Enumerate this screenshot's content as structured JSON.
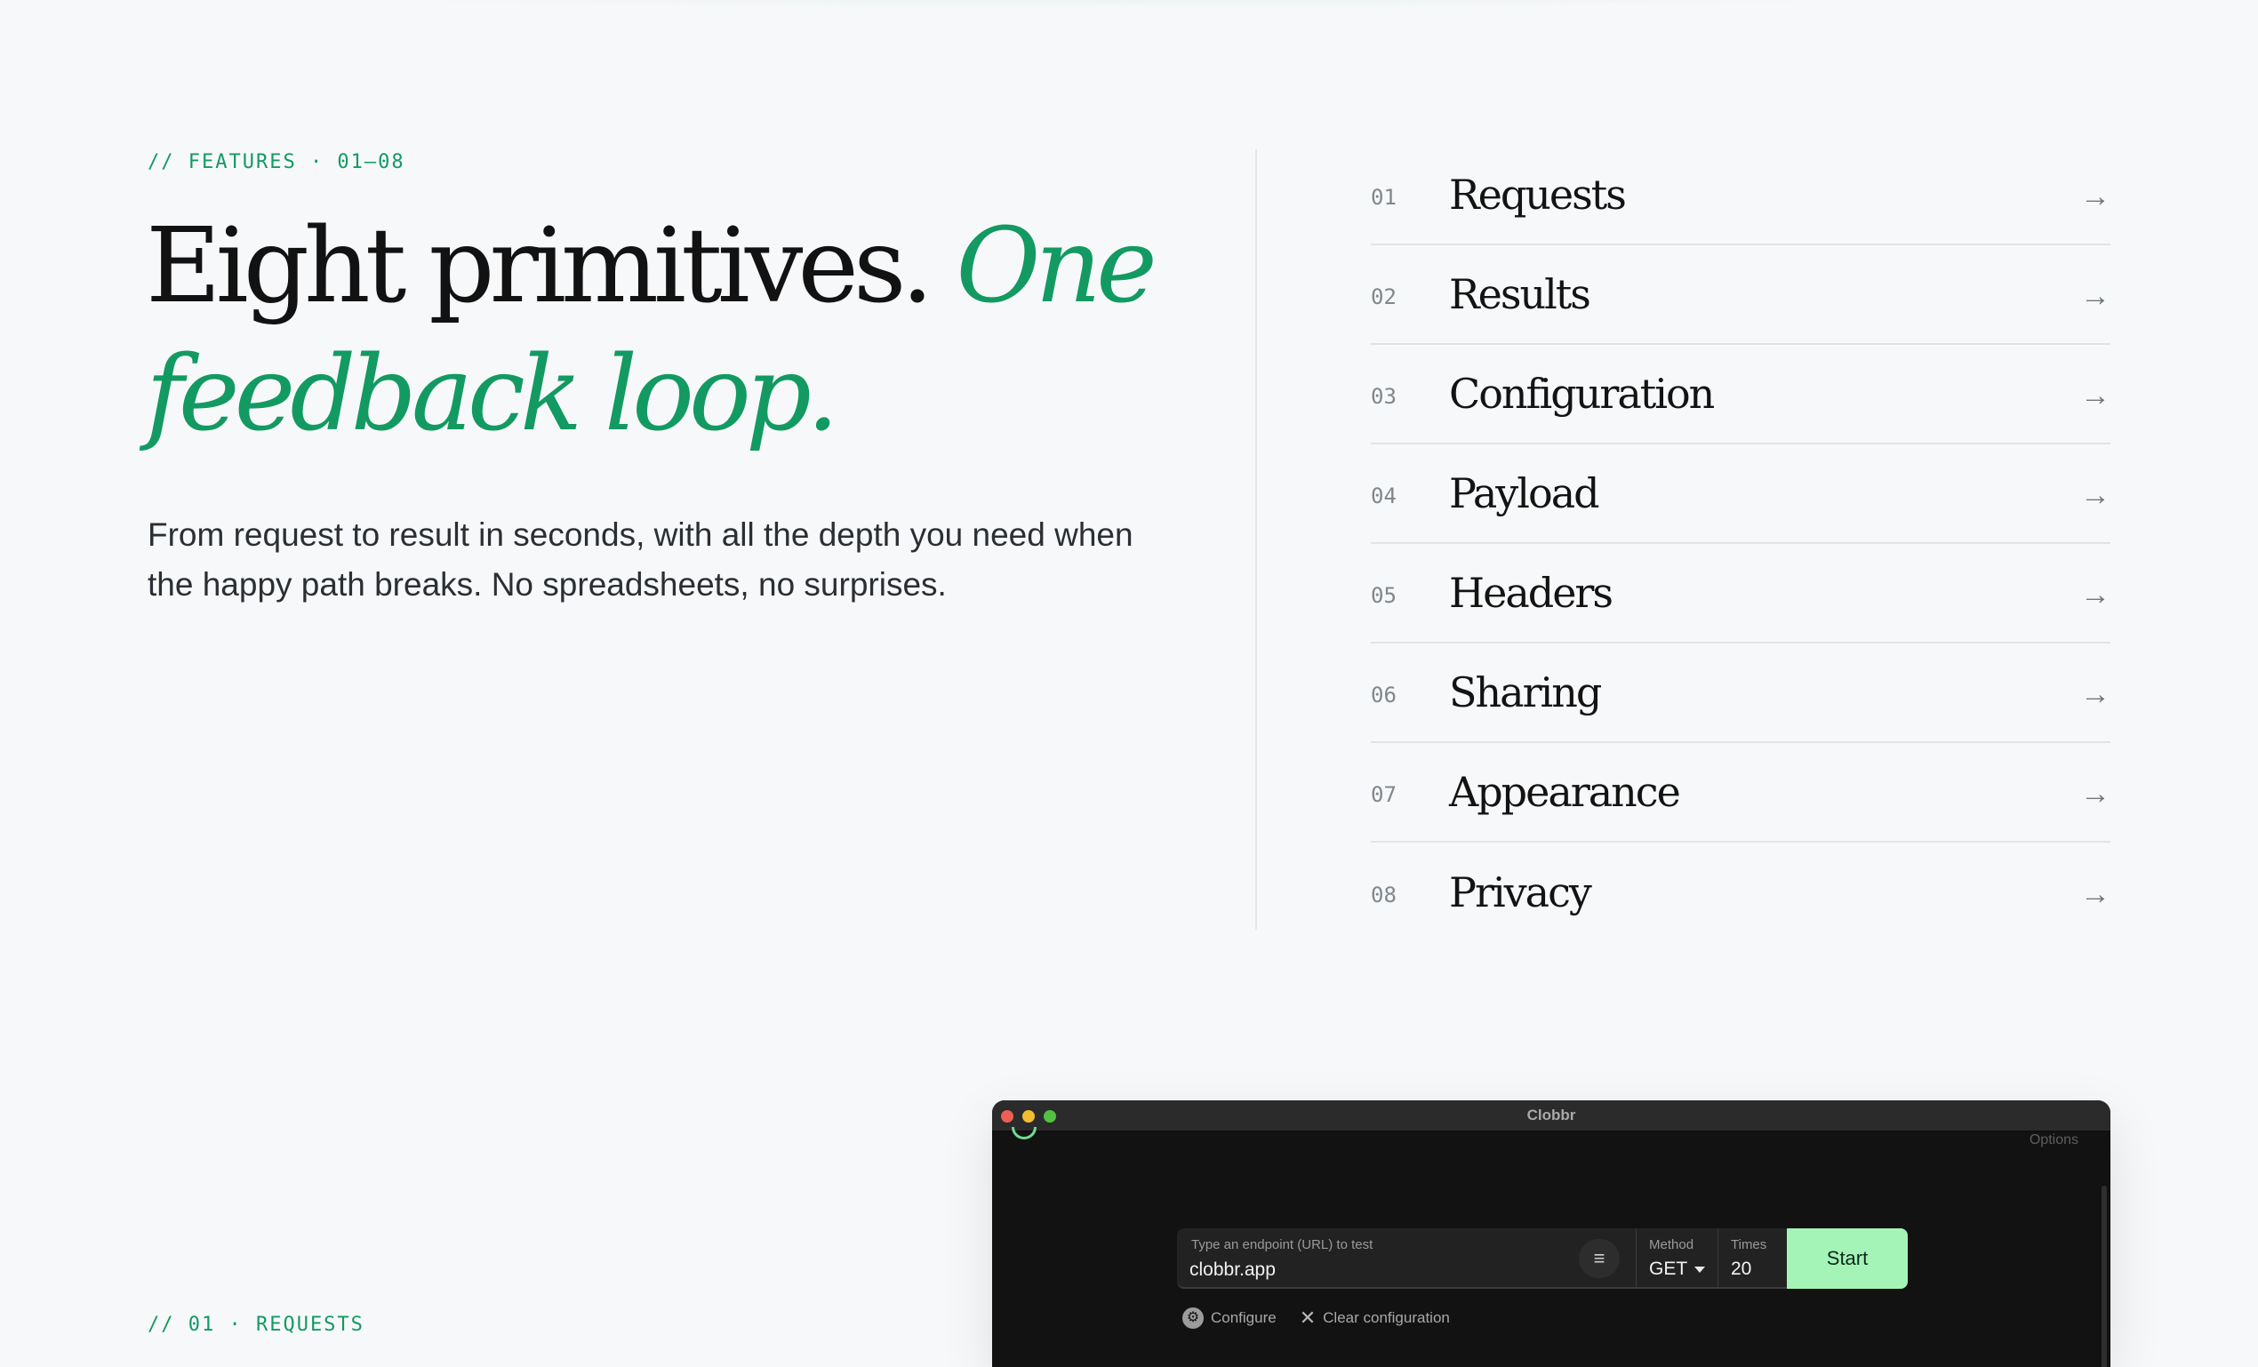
{
  "features_section": {
    "eyebrow": "// FEATURES · 01–08",
    "headline_plain": "Eight primitives.",
    "headline_accent": "One feedback loop.",
    "lede": "From request to result in seconds, with all the depth you need when the happy path breaks. No spreadsheets, no surprises.",
    "accent_color": "#129a62",
    "arrow_glyph": "→",
    "items": [
      {
        "num": "01",
        "label": "Requests"
      },
      {
        "num": "02",
        "label": "Results"
      },
      {
        "num": "03",
        "label": "Configuration"
      },
      {
        "num": "04",
        "label": "Payload"
      },
      {
        "num": "05",
        "label": "Headers"
      },
      {
        "num": "06",
        "label": "Sharing"
      },
      {
        "num": "07",
        "label": "Appearance"
      },
      {
        "num": "08",
        "label": "Privacy"
      }
    ]
  },
  "requests_section": {
    "eyebrow": "// 01 · REQUESTS"
  },
  "app_window": {
    "title": "Clobbr",
    "options_label": "Options",
    "url_label": "Type an endpoint (URL) to test",
    "url_value": "clobbr.app",
    "method_label": "Method",
    "method_value": "GET",
    "times_label": "Times",
    "times_value": "20",
    "start_label": "Start",
    "configure_label": "Configure",
    "clear_label": "Clear configuration",
    "start_button_color": "#a4f4b8"
  }
}
